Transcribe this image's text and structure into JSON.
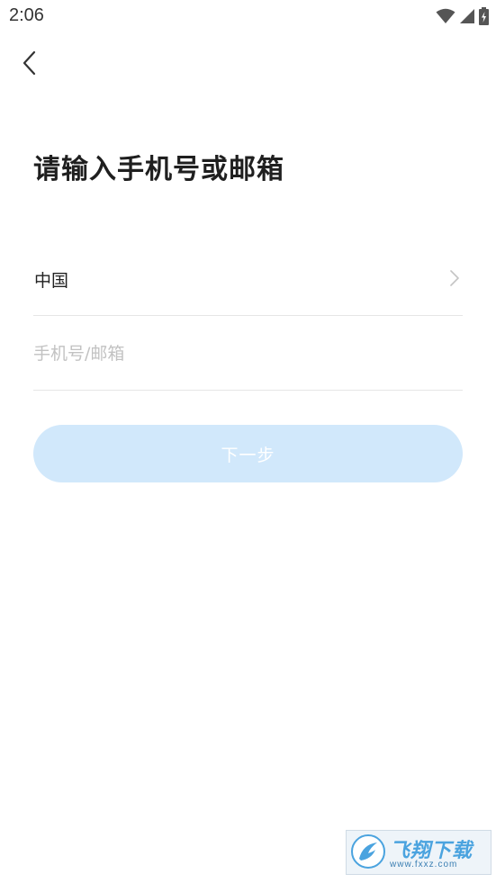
{
  "status_bar": {
    "time": "2:06",
    "icons": [
      "wifi-icon",
      "signal-icon",
      "battery-charging-icon"
    ]
  },
  "nav": {
    "back_icon": "chevron-left-icon"
  },
  "title": "请输入手机号或邮箱",
  "region": {
    "label": "中国",
    "chevron_icon": "chevron-right-icon"
  },
  "account": {
    "value": "",
    "placeholder": "手机号/邮箱"
  },
  "next_button": {
    "label": "下一步"
  },
  "watermark": {
    "brand": "飞翔下载",
    "url": "www.fxxz.com"
  },
  "colors": {
    "button_bg": "#d1e8fb",
    "button_text": "#ffffff",
    "divider": "#e6e6e6",
    "placeholder": "#c2c2c2",
    "title": "#1f1f1f"
  }
}
